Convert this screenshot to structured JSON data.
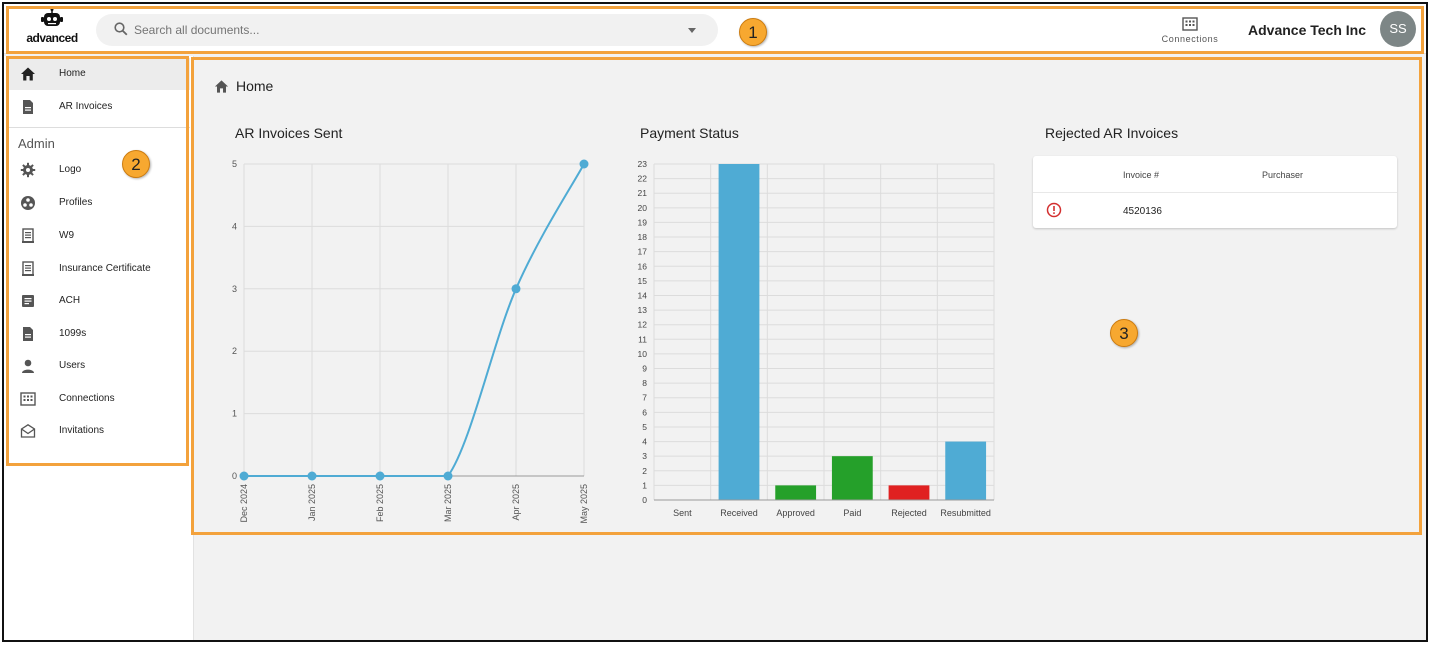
{
  "topbar": {
    "logo_text": "advanced",
    "search_placeholder": "Search all documents...",
    "connections_label": "Connections",
    "company_name": "Advance Tech Inc",
    "avatar_initials": "SS"
  },
  "annotations": [
    "1",
    "2",
    "3"
  ],
  "sidebar": {
    "items": [
      {
        "label": "Home",
        "icon": "home-icon"
      },
      {
        "label": "AR Invoices",
        "icon": "document-icon"
      }
    ],
    "admin_title": "Admin",
    "admin_items": [
      {
        "label": "Logo",
        "icon": "gear-icon"
      },
      {
        "label": "Profiles",
        "icon": "profiles-icon"
      },
      {
        "label": "W9",
        "icon": "form-icon"
      },
      {
        "label": "Insurance Certificate",
        "icon": "certificate-icon"
      },
      {
        "label": "ACH",
        "icon": "ach-icon"
      },
      {
        "label": "1099s",
        "icon": "document-icon"
      },
      {
        "label": "Users",
        "icon": "user-icon"
      },
      {
        "label": "Connections",
        "icon": "building-icon"
      },
      {
        "label": "Invitations",
        "icon": "envelope-icon"
      }
    ]
  },
  "main": {
    "title": "Home"
  },
  "chart_data": [
    {
      "type": "line",
      "title": "AR Invoices Sent",
      "categories": [
        "Dec 2024",
        "Jan 2025",
        "Feb 2025",
        "Mar 2025",
        "Apr 2025",
        "May 2025"
      ],
      "values": [
        0,
        0,
        0,
        0,
        3,
        5
      ],
      "ylim": [
        0,
        5
      ],
      "yticks": [
        0,
        1,
        2,
        3,
        4,
        5
      ],
      "color": "#4fabd4",
      "grid": true
    },
    {
      "type": "bar",
      "title": "Payment Status",
      "categories": [
        "Sent",
        "Received",
        "Approved",
        "Paid",
        "Rejected",
        "Resubmitted"
      ],
      "values": [
        0,
        23,
        1,
        3,
        1,
        4
      ],
      "colors": [
        "#4fabd4",
        "#4fabd4",
        "#25a02a",
        "#25a02a",
        "#e02121",
        "#4fabd4"
      ],
      "ylim": [
        0,
        23
      ],
      "yticks": [
        0,
        1,
        2,
        3,
        4,
        5,
        6,
        7,
        8,
        9,
        10,
        11,
        12,
        13,
        14,
        15,
        16,
        17,
        18,
        19,
        20,
        21,
        22,
        23
      ],
      "grid": true
    }
  ],
  "rejected": {
    "title": "Rejected AR Invoices",
    "columns": [
      "Invoice #",
      "Purchaser"
    ],
    "rows": [
      {
        "invoice": "4520136",
        "purchaser": ""
      }
    ],
    "error_color": "#d32f2f"
  }
}
